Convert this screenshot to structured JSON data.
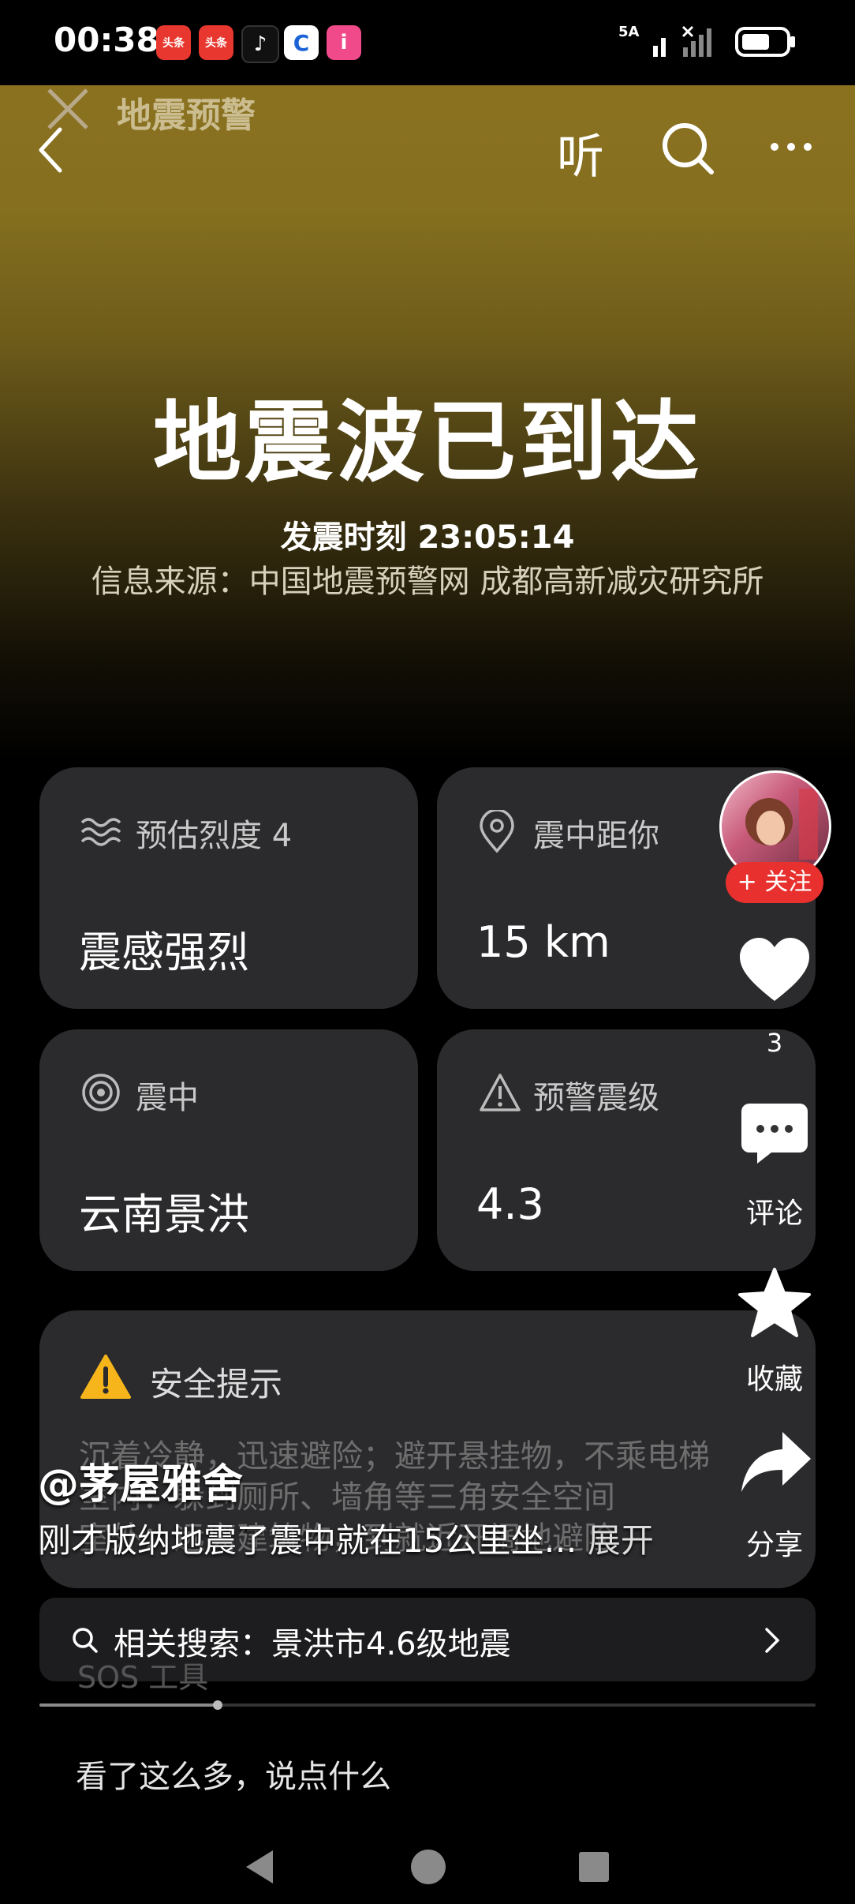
{
  "status": {
    "time": "00:38",
    "app_icons": [
      {
        "label": "头条",
        "color": "#e8372e"
      },
      {
        "label": "头条",
        "color": "#e8372e"
      },
      {
        "label": "♪",
        "color": "#111111"
      },
      {
        "label": "C",
        "color": "#1a62d6"
      },
      {
        "label": "i",
        "color": "#f04a8a"
      }
    ],
    "signal_label": "5A"
  },
  "topbar": {
    "overlay_title": "地震预警",
    "listen_label": "听"
  },
  "hero": {
    "headline": "地震波已到达",
    "time_line": "发震时刻 23:05:14",
    "source_line": "信息来源：中国地震预警网 成都高新减灾研究所"
  },
  "cards": {
    "intensity": {
      "label": "预估烈度 4",
      "value": "震感强烈"
    },
    "distance": {
      "label": "震中距你",
      "value": "15 km"
    },
    "epicenter": {
      "label": "震中",
      "value": "云南景洪"
    },
    "magnitude": {
      "label": "预警震级",
      "value": "4.3"
    }
  },
  "safety": {
    "title": "安全提示",
    "line1": "沉着冷静，迅速避险；避开悬挂物，不乘电梯",
    "line2": "室内：躲到厕所、墙角等三角安全空间",
    "line3": "室外：远离建筑物，到就近开阔地避险"
  },
  "overlay": {
    "author": "@茅屋雅舍",
    "caption": "刚才版纳地震了震中就在15公里坐…",
    "expand": "展开"
  },
  "side": {
    "follow_label": "+ 关注",
    "like_count": "3",
    "comment_label": "评论",
    "collect_label": "收藏",
    "share_label": "分享"
  },
  "search": {
    "label": "相关搜索：景洪市4.6级地震",
    "hidden_text": "SOS 工具"
  },
  "progress": {
    "fraction": 0.23
  },
  "comment_box": {
    "placeholder": "看了这么多，说点什么"
  },
  "colors": {
    "accent_red": "#e8312f",
    "warning_yellow": "#f5b51b",
    "card_bg": "#2b2b2d"
  }
}
